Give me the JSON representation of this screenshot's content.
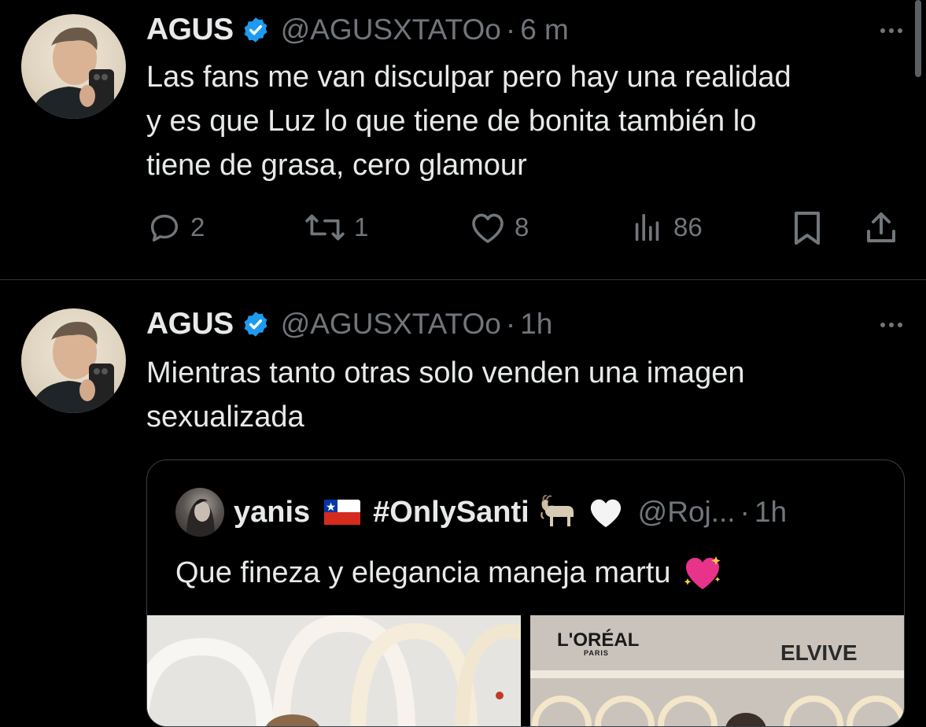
{
  "colors": {
    "background": "#000000",
    "text_primary": "#e7e9ea",
    "text_secondary": "#71767b",
    "verified": "#1d9bf0",
    "divider": "#2f3336"
  },
  "tweets": [
    {
      "author_name": "AGUS",
      "handle": "@AGUSXTATOo",
      "separator": "·",
      "time": "6 m",
      "text": "Las fans me van disculpar pero hay una realidad\ny es que Luz lo que tiene de bonita también lo\ntiene de grasa, cero glamour",
      "replies": "2",
      "reposts": "1",
      "likes": "8",
      "views": "86",
      "icons": [
        "verified-icon",
        "more-icon",
        "reply-icon",
        "repost-icon",
        "like-icon",
        "views-icon",
        "bookmark-icon",
        "share-icon"
      ]
    },
    {
      "author_name": "AGUS",
      "handle": "@AGUSXTATOo",
      "separator": "·",
      "time": "1h",
      "text": "Mientras tanto otras solo venden una imagen\nsexualizada",
      "quote": {
        "author_name": "yanis",
        "hashtag": "#OnlySanti",
        "handle": "@Roj...",
        "separator": "·",
        "time": "1h",
        "text": "Que fineza y elegancia maneja martu",
        "emojis": [
          "chile-flag-icon",
          "goat-icon",
          "white-heart-icon",
          "sparkling-heart-icon"
        ],
        "media": {
          "right_brand_1": "L'ORÉAL",
          "right_brand_1_sub": "PARIS",
          "right_brand_2": "ELVIVE"
        }
      }
    }
  ]
}
